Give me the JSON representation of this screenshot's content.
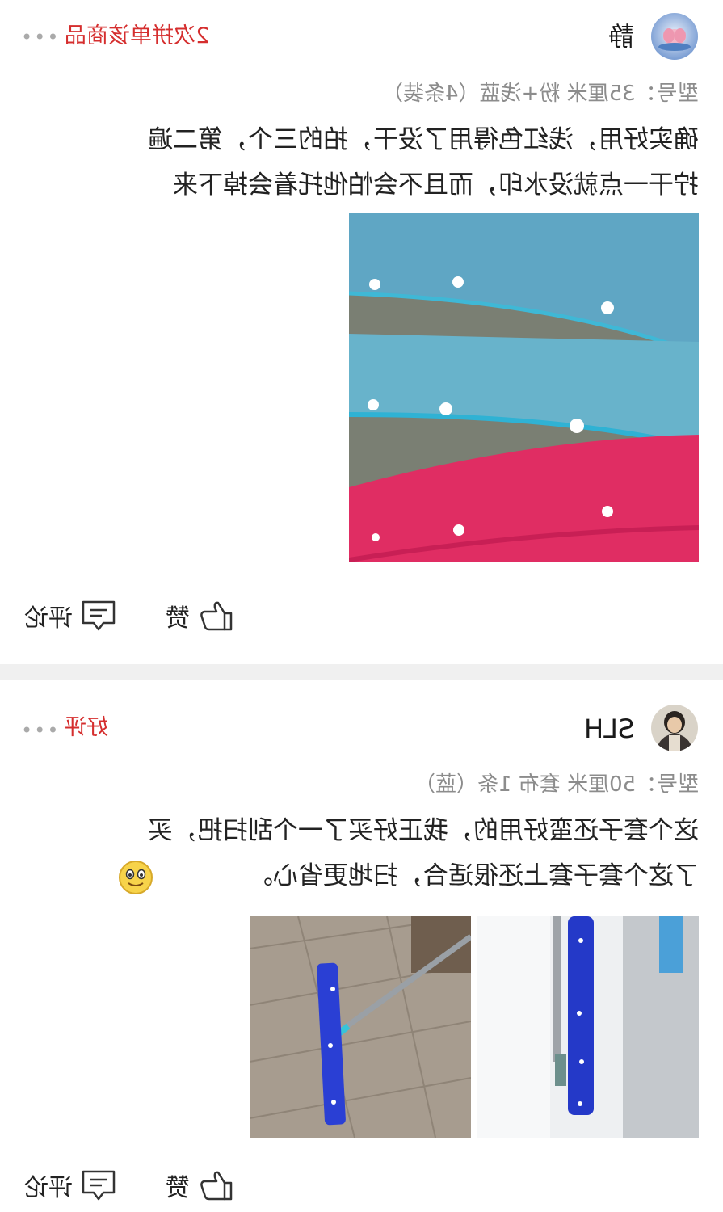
{
  "reviews": [
    {
      "username": "静",
      "tag": "2次拼单该商品",
      "more_icon": "more-icon",
      "spec": "型号：35厘米 粉+浅蓝（4条装）",
      "text_line1": "确实好用，浅红色得用了没干，拍的三个，第二遍",
      "text_line2": "拧干一点就没水印，而且不会怕他托着会掉下来",
      "photo_icon": "towel-straps-photo",
      "comment_label": "评论",
      "like_label": "赞"
    },
    {
      "username": "SLH",
      "tag": "好评",
      "more_icon": "more-icon",
      "spec": "型号：50厘米 套布 1条（蓝）",
      "text_line1": "这个套子还蛮好用的，我正好买了一个刮扫把，买",
      "text_line2": "了这个套子套上还很适合，扫地更省心。",
      "emoji": "smiling-face-emoji",
      "photo_icons": [
        "mop-on-floor-photo",
        "mop-standing-photo"
      ],
      "comment_label": "评论",
      "like_label": "赞"
    }
  ],
  "colors": {
    "tag_red": "#d52e2e",
    "divider": "#f0f0f0",
    "spec_gray": "#8c8c8c"
  }
}
